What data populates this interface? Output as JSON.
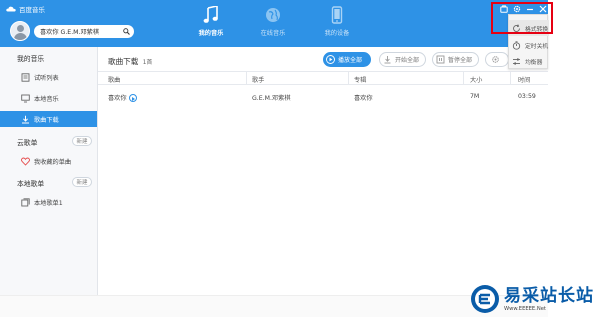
{
  "window": {
    "app_title": "百度音乐",
    "user": {
      "display_text": "喜欢你 G.E.M.邓紫棋"
    },
    "nav": [
      {
        "label": "我的音乐",
        "icon": "music-note-icon",
        "active": true
      },
      {
        "label": "在线音乐",
        "icon": "globe-icon",
        "active": false
      },
      {
        "label": "我的设备",
        "icon": "phone-icon",
        "active": false
      }
    ]
  },
  "sidebar": {
    "sections": [
      {
        "title": "我的音乐"
      },
      {
        "title": "云歌单",
        "new_label": "新建"
      },
      {
        "title": "本地歌单",
        "new_label": "新建"
      }
    ],
    "items": [
      {
        "label": "试听列表",
        "icon": "list-icon",
        "active": false
      },
      {
        "label": "本地音乐",
        "icon": "monitor-icon",
        "active": false
      },
      {
        "label": "歌曲下载",
        "icon": "download-icon",
        "active": true
      },
      {
        "label": "我收藏的单曲",
        "icon": "heart-icon",
        "active": false
      },
      {
        "label": "本地歌单1",
        "icon": "playlist-icon",
        "active": false
      }
    ]
  },
  "main": {
    "title": "歌曲下载",
    "count": "1首",
    "toolbar": {
      "play_all": "播放全部",
      "start_all": "开始全部",
      "pause_all": "暂停全部"
    },
    "columns": [
      "歌曲",
      "歌手",
      "专辑",
      "大小",
      "时间"
    ],
    "rows": [
      {
        "song": "喜欢你",
        "artist": "G.E.M.邓紫棋",
        "album": "喜欢你",
        "size": "7M",
        "time": "03:59"
      }
    ]
  },
  "dropdown": {
    "items": [
      {
        "label": "格式转换",
        "icon": "refresh-icon"
      },
      {
        "label": "定时关机",
        "icon": "timer-icon"
      },
      {
        "label": "均衡器",
        "icon": "equalizer-icon"
      }
    ]
  },
  "watermark": {
    "text_cn": "易采站长站",
    "text_en": "Www.EEEEE.Net"
  },
  "colors": {
    "accent": "#2e92e6",
    "highlight_border": "#e60012"
  }
}
